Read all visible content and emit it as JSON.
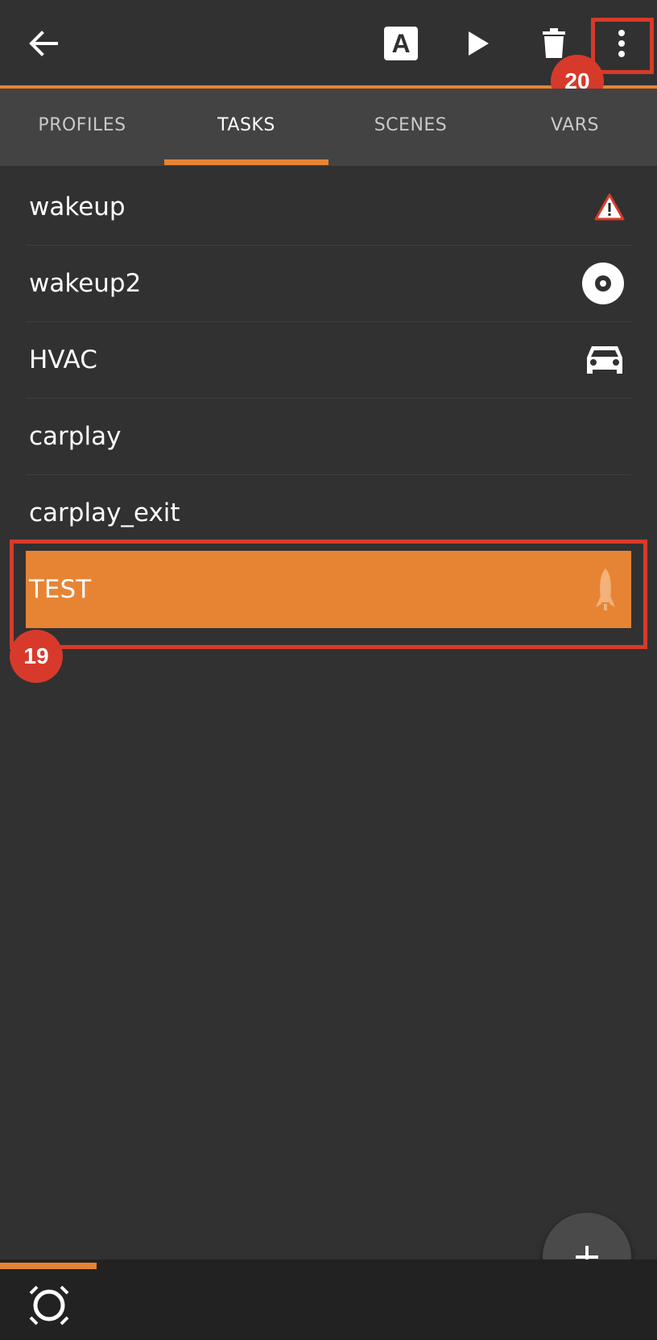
{
  "toolbar": {
    "back_icon": "arrow-left-icon",
    "a_label": "A",
    "play_icon": "play-icon",
    "trash_icon": "trash-icon",
    "more_icon": "more-vertical-icon"
  },
  "tabs": [
    {
      "label": "PROFILES",
      "active": false
    },
    {
      "label": "TASKS",
      "active": true
    },
    {
      "label": "SCENES",
      "active": false
    },
    {
      "label": "VARS",
      "active": false
    }
  ],
  "tasks": [
    {
      "label": "wakeup",
      "icon": "warning-icon"
    },
    {
      "label": "wakeup2",
      "icon": "disc-icon"
    },
    {
      "label": "HVAC",
      "icon": "car-icon"
    },
    {
      "label": "carplay",
      "icon": ""
    },
    {
      "label": "carplay_exit",
      "icon": ""
    },
    {
      "label": "TEST",
      "icon": "rocket-icon",
      "selected": true
    }
  ],
  "markers": {
    "more_badge": "20",
    "test_badge": "19"
  },
  "colors": {
    "accent": "#e68434",
    "background": "#313131",
    "tabbar": "#434343",
    "marker": "#d73a2a"
  },
  "fab": {
    "icon": "plus-icon"
  },
  "bottom": {
    "icon": "tasker-logo-icon"
  }
}
